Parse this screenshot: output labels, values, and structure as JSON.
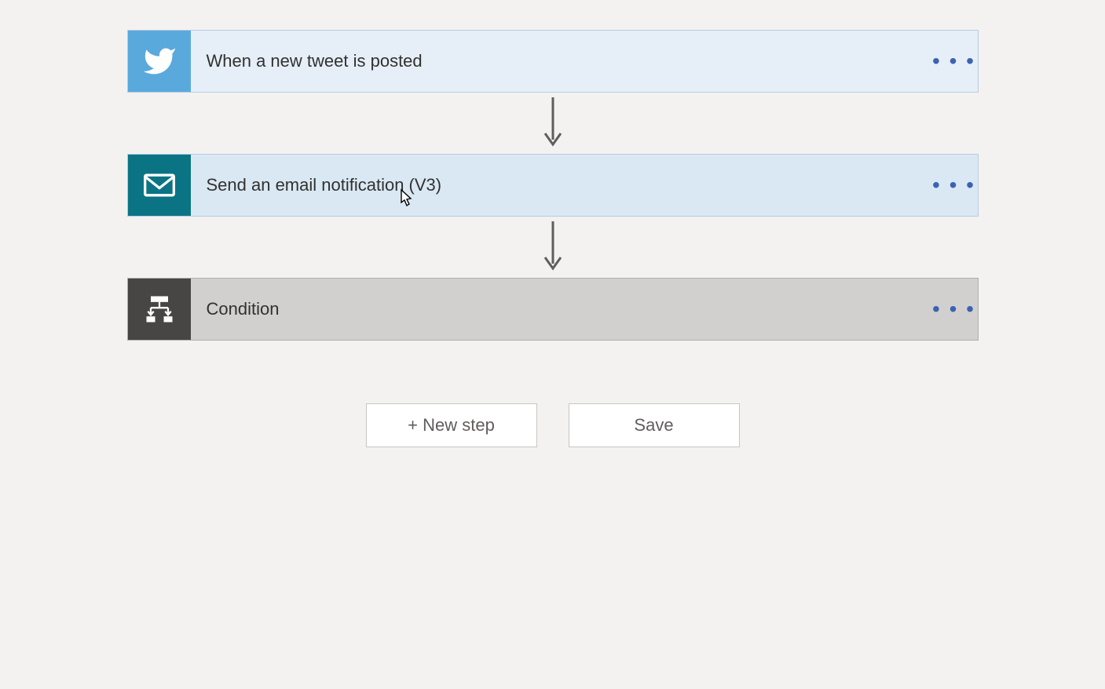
{
  "steps": {
    "twitter": {
      "label": "When a new tweet is posted",
      "icon_color": "#5aa9dd"
    },
    "email": {
      "label": "Send an email notification (V3)",
      "icon_color": "#0a7484"
    },
    "condition": {
      "label": "Condition",
      "icon_color": "#484644"
    }
  },
  "buttons": {
    "new_step": "+ New step",
    "save": "Save"
  },
  "menu_dots": "• • •"
}
